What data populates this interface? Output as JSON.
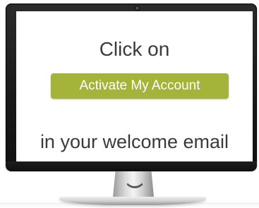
{
  "screen": {
    "heading": "Click on",
    "button_label": "Activate My Account",
    "footer_text": "in your welcome email"
  },
  "colors": {
    "button_bg": "#a4b43a",
    "button_text": "#ffffff",
    "text": "#3a3a3a",
    "bezel": "#1a1a1a"
  },
  "icons": {
    "device": "desktop-monitor",
    "camera": "webcam-dot"
  }
}
